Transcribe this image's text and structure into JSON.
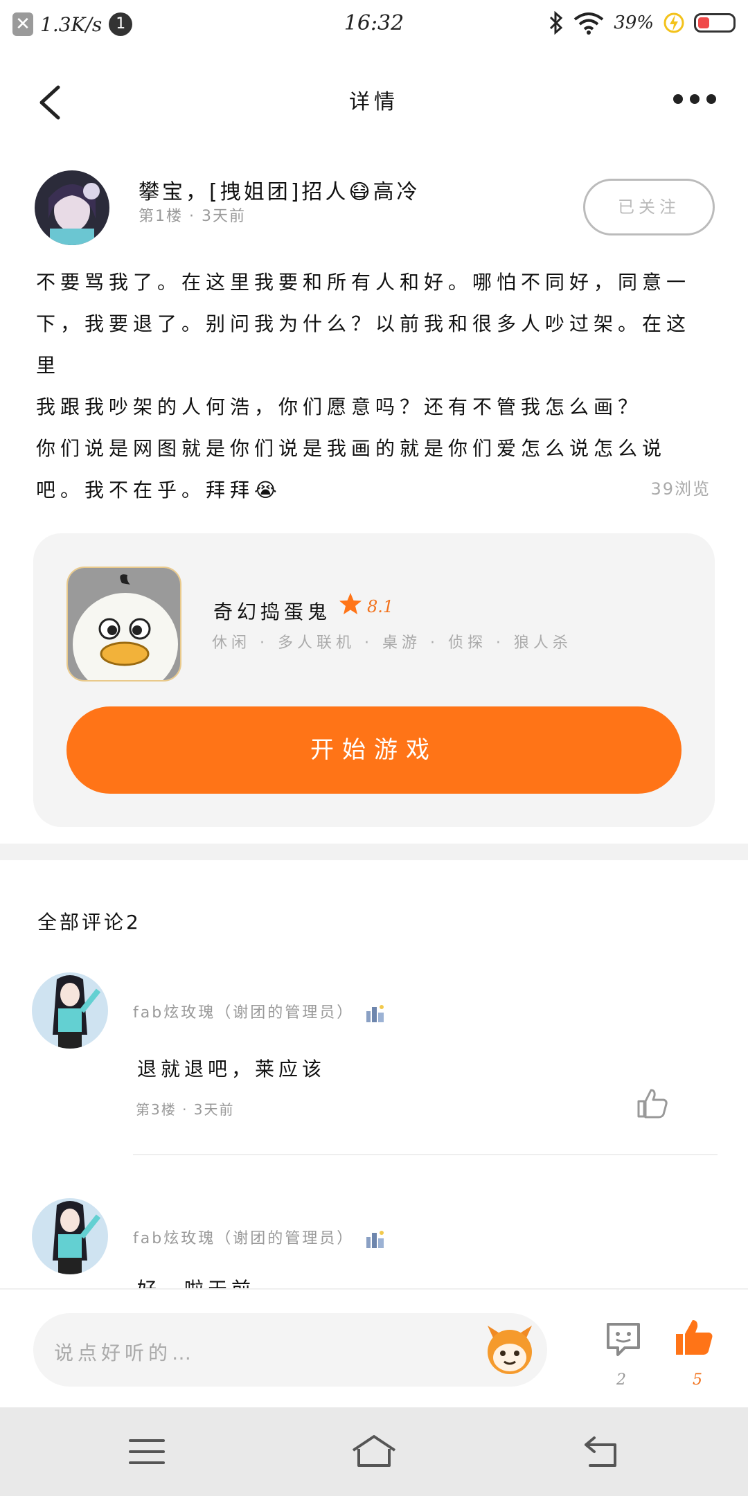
{
  "status_bar": {
    "speed": "1.3K/s",
    "notif_count": "1",
    "time": "16:32",
    "battery_pct": "39%",
    "icons": [
      "close-notification-icon",
      "bluetooth-icon",
      "wifi-icon",
      "charging-icon",
      "battery-icon"
    ]
  },
  "header": {
    "title": "详情",
    "back_icon": "chevron-left-icon",
    "more_icon": "more-dots-icon"
  },
  "post": {
    "author_name": "攀宝，[拽姐团]招人😷高冷",
    "author_meta": "第1楼 · 3天前",
    "follow_label": "已关注",
    "paragraphs": [
      "不要骂我了。在这里我要和所有人和好。哪怕不同好，同意一下，我要退了。别问我为什么？以前我和很多人吵过架。在这里",
      "我跟我吵架的人何浩，你们愿意吗？还有不管我怎么画？",
      "你们说是网图就是你们说是我画的就是你们爱怎么说怎么说吧。我不在乎。拜拜😭"
    ],
    "views": "39浏览"
  },
  "game": {
    "name": "奇幻捣蛋鬼",
    "rating": "8.1",
    "tags": "休闲 · 多人联机 · 桌游 · 侦探 · 狼人杀",
    "start_label": "开始游戏",
    "icon": "duck-game-icon",
    "accent": "#ff7417"
  },
  "comments": {
    "title": "全部评论2",
    "items": [
      {
        "name": "fab炫玫瑰（谢团的管理员）",
        "text": "退就退吧，莱应该",
        "meta": "第3楼 · 3天前"
      },
      {
        "name": "fab炫玫瑰（谢团的管理员）",
        "text": "好…啦天前"
      }
    ]
  },
  "bottom": {
    "input_placeholder": "说点好听的…",
    "chat_count": "2",
    "like_count": "5"
  },
  "navbar": {
    "icons": [
      "menu-icon",
      "home-icon",
      "back-icon"
    ]
  }
}
